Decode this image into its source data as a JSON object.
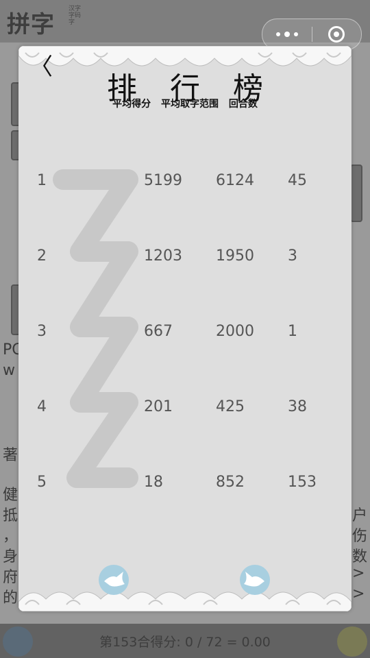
{
  "background": {
    "logo": "拼字",
    "logo_sub": "汉字字码字",
    "score_line": "第153合得分: 0 / 72 = 0.00",
    "side_texts": [
      "PC",
      "w",
      "著",
      "健",
      "抵",
      "，",
      "身",
      "府",
      "的",
      "户",
      "伤",
      "数",
      ">",
      ">"
    ]
  },
  "capsule": {
    "more_icon": "more-dots-icon",
    "close_icon": "target-close-icon"
  },
  "modal": {
    "back_label": "〈",
    "title": "排行榜",
    "headers": [
      "平均得分",
      "平均取字范围",
      "回合数"
    ],
    "rows": [
      {
        "rank": "1",
        "score": "5199",
        "range": "6124",
        "rounds": "45"
      },
      {
        "rank": "2",
        "score": "1203",
        "range": "1950",
        "rounds": "3"
      },
      {
        "rank": "3",
        "score": "667",
        "range": "2000",
        "rounds": "1"
      },
      {
        "rank": "4",
        "score": "201",
        "range": "425",
        "rounds": "38"
      },
      {
        "rank": "5",
        "score": "18",
        "range": "852",
        "rounds": "153"
      }
    ],
    "prev_icon": "bird-left-icon",
    "next_icon": "bird-right-icon"
  }
}
